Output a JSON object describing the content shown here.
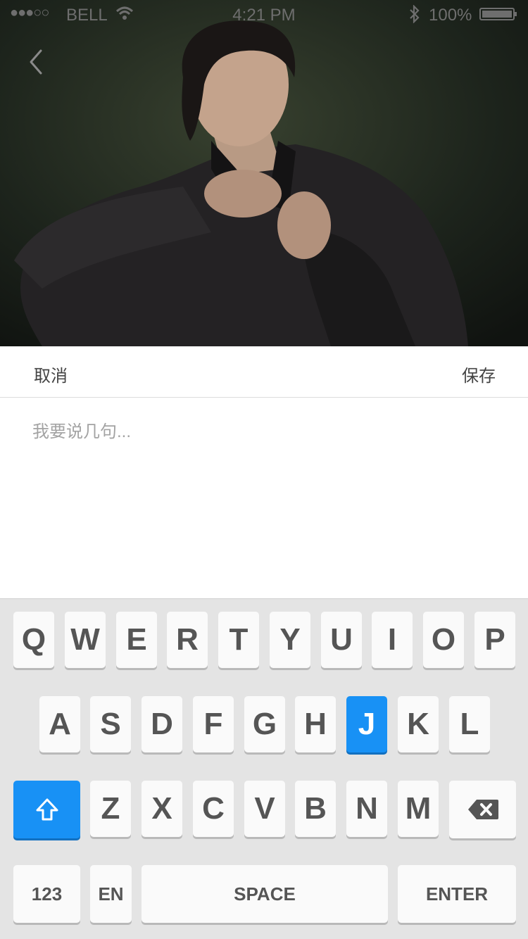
{
  "status_bar": {
    "signal_dots": "●●●○○",
    "carrier": "BELL",
    "time": "4:21 PM",
    "battery_percent": "100%",
    "icons": [
      "wifi-icon",
      "bluetooth-icon",
      "battery-icon"
    ]
  },
  "header": {
    "back_icon": "chevron-left-icon",
    "photo": "man-in-black-shirt-photo"
  },
  "actions": {
    "cancel_label": "取消",
    "save_label": "保存"
  },
  "compose": {
    "placeholder": "我要说几句...",
    "value": ""
  },
  "keyboard": {
    "row1": [
      "Q",
      "W",
      "E",
      "R",
      "T",
      "Y",
      "U",
      "I",
      "O",
      "P"
    ],
    "row2": [
      "A",
      "S",
      "D",
      "F",
      "G",
      "H",
      "J",
      "K",
      "L"
    ],
    "row3": [
      "Z",
      "X",
      "C",
      "V",
      "B",
      "N",
      "M"
    ],
    "shift_icon": "shift-arrow-icon",
    "backspace_icon": "backspace-icon",
    "numbers_label": "123",
    "lang_label": "EN",
    "space_label": "SPACE",
    "enter_label": "ENTER",
    "highlighted_key": "J",
    "accent_color": "#1891F5"
  }
}
